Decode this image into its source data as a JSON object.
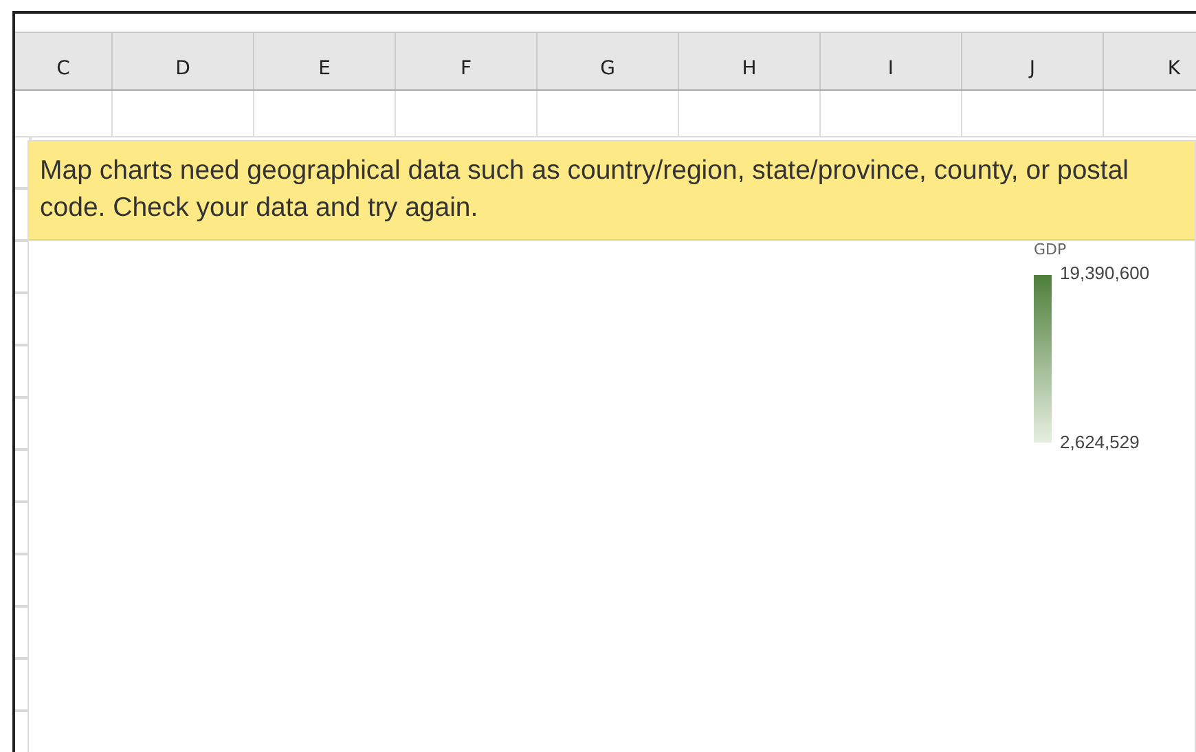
{
  "column_headers": [
    "C",
    "D",
    "E",
    "F",
    "G",
    "H",
    "I",
    "J",
    "K"
  ],
  "chart": {
    "message": "Map charts need geographical data such as country/region, state/province, county, or postal code. Check your data and try again.",
    "legend": {
      "title": "GDP",
      "max_label": "19,390,600",
      "min_label": "2,624,529"
    }
  }
}
